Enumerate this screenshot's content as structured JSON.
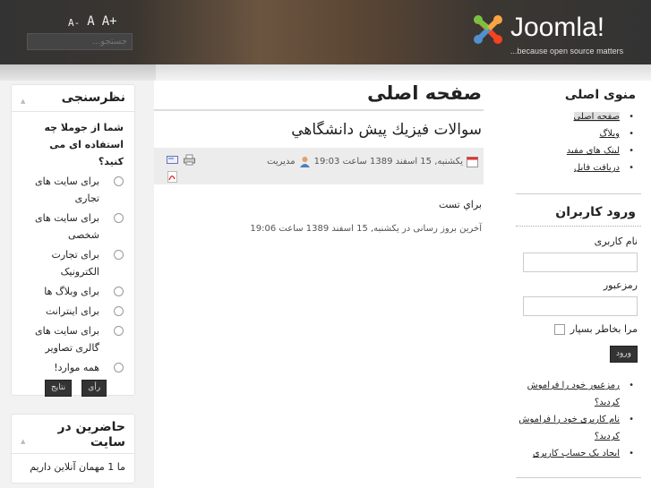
{
  "header": {
    "font_sizes": [
      "A-",
      "A",
      "A+"
    ],
    "search_placeholder": "جستجو...",
    "logo_text": "Joomla!",
    "logo_tag": "...because open source matters"
  },
  "poll": {
    "title": "نظرسنجی",
    "question": "شما از جوملا چه استفاده ای می کنید؟",
    "options": [
      "برای سایت های تجاری",
      "برای سایت های شخصی",
      "برای تجارت الکترونیک",
      "برای وبلاگ ها",
      "برای اینترانت",
      "برای سایت های گالری تصاویر",
      "همه موارد!"
    ],
    "vote": "رأی",
    "results": "نتایج"
  },
  "online": {
    "title": "حاضرین در سایت",
    "text": "ما 1 مهمان آنلاین داریم"
  },
  "main": {
    "page_title": "صفحه اصلی",
    "article_title": "سوالات فيزيك پيش دانشگاهي",
    "date": "یکشنبه, 15 اسفند 1389 ساعت 19:03",
    "author": "مدیریت",
    "body": "براي تست",
    "updated": "آخرین بروز رسانی در یکشنبه, 15 اسفند 1389 ساعت 19:06"
  },
  "menu": {
    "title": "منوی اصلی",
    "items": [
      "صفحه اصلی",
      "وبلاگ",
      "لینک های مفید",
      "دریافت فایل"
    ]
  },
  "login": {
    "title": "ورود کاربران",
    "username_label": "نام کاربری",
    "password_label": "رمزعبور",
    "remember": "مرا بخاطر بسپار",
    "submit": "ورود",
    "links": [
      "رمزعبور خود را فراموش کردید؟",
      "نام کاربری خود را فراموش کردید؟",
      "ایجاد یک حساب کاربری"
    ]
  }
}
